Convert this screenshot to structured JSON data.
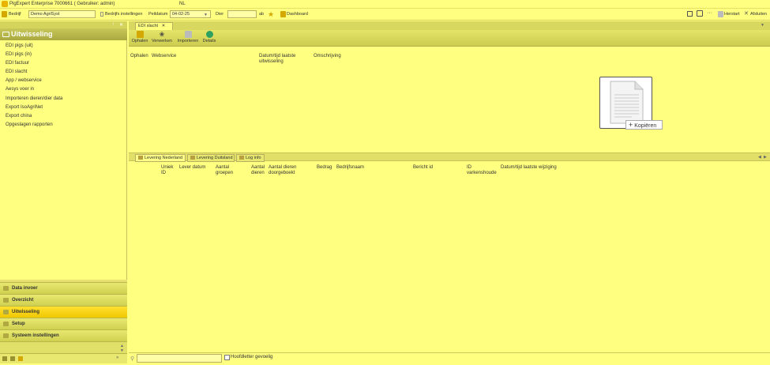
{
  "window": {
    "title": "PigExpert Enterprise 7000661  ( Gebruiker: admin)",
    "language": "NL"
  },
  "toolbar": {
    "bedrijf_label": "Bedrijf",
    "bedrijf_value": "Demo AgriSyst",
    "bedrijfs_instellingen": "Bedrijfs instellingen",
    "peildatum_label": "Peildatum",
    "peildatum_value": "04-02-25",
    "dier_label": "Dier",
    "dier_value": "",
    "ab_label": "ab",
    "dashboard": "Dashboard",
    "herstart": "Herstart",
    "afsluiten": "Afsluiten"
  },
  "sidebar": {
    "header": "Uitwisseling",
    "items": [
      {
        "label": "EDI pigs (uit)"
      },
      {
        "label": "EDI pigs (in)"
      },
      {
        "label": "EDI factuur"
      },
      {
        "label": "EDI slacht"
      },
      {
        "label": "App / webservice"
      },
      {
        "label": "Aesys voer in"
      },
      {
        "label": "Importeren dieren/dier data"
      },
      {
        "label": "Export IsoAgriNet"
      },
      {
        "label": "Export china"
      },
      {
        "label": "Opgeslagen rapporten"
      }
    ],
    "bottom_nav": [
      {
        "label": "Data invoer"
      },
      {
        "label": "Overzicht"
      },
      {
        "label": "Uitwisseling"
      },
      {
        "label": "Setup"
      },
      {
        "label": "Systeem instellingen"
      }
    ]
  },
  "main": {
    "tab_label": "EDI slacht",
    "ribbon": [
      {
        "label": "Ophalen"
      },
      {
        "label": "Verwerken"
      },
      {
        "label": "Importeren"
      },
      {
        "label": "Details"
      }
    ],
    "top_columns": {
      "c1": "Ophalen",
      "c2": "Webservice",
      "c3_line1": "Datum/tijd laatste",
      "c3_line2": "uitwisseling",
      "c4": "Omschrijving"
    },
    "copy_button": "Kopiëren",
    "lower_tabs": [
      {
        "label": "Levering Nederland"
      },
      {
        "label": "Levering Duitsland"
      },
      {
        "label": "Log info"
      }
    ],
    "lower_columns": {
      "uniek_1": "Uniek",
      "uniek_2": "ID",
      "lever_datum": "Lever datum",
      "aantal_groepen_1": "Aantal",
      "aantal_groepen_2": "groepen",
      "aantal_dieren_1": "Aantal",
      "aantal_dieren_2": "dieren",
      "doorgeboekt_1": "Aantal dieren",
      "doorgeboekt_2": "doorgeboekt",
      "bedrag": "Bedrag",
      "bedrijfsnaam": "Bedrijfsnaam",
      "bericht_id": "Bericht id",
      "varkenshouder_1": "ID",
      "varkenshouder_2": "varkenshoude",
      "laatste_wijziging": "Datum/tijd laatste wijziging"
    },
    "footer": {
      "search_value": "",
      "case_sensitive_label": "Hoofdletter gevoelig"
    }
  },
  "colors": {
    "background": "#ffff80",
    "header": "#a8a840",
    "active_nav": "#f0c800"
  }
}
